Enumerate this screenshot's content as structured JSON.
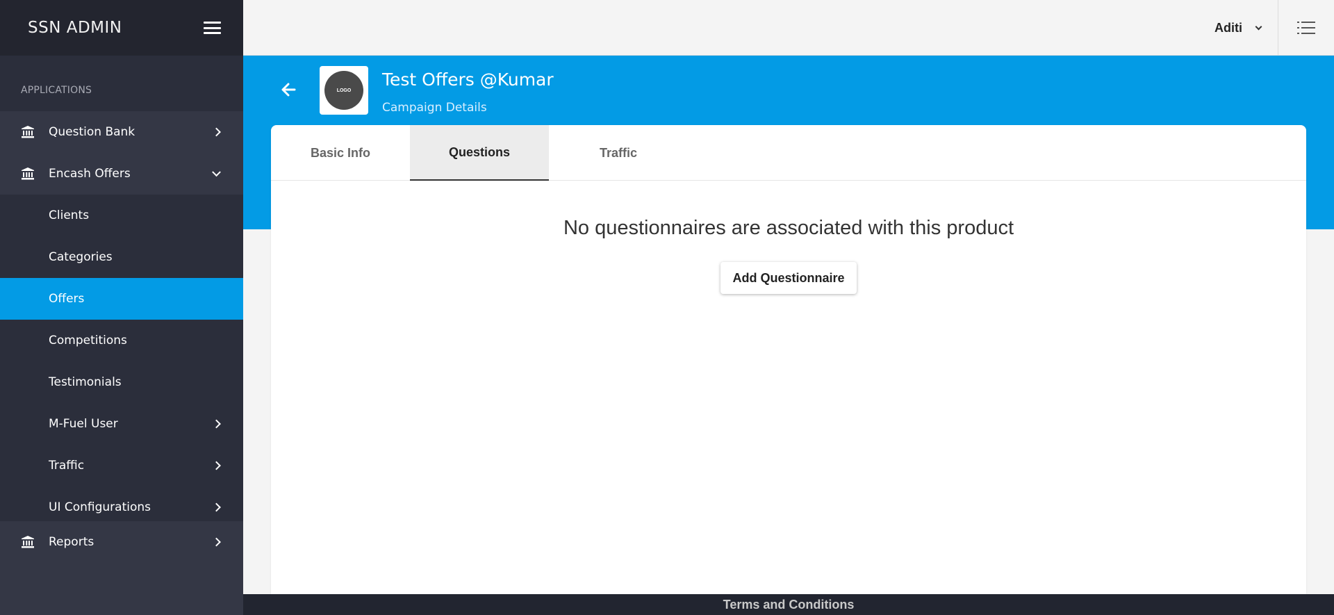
{
  "brand": {
    "title": "SSN ADMIN"
  },
  "sidebar": {
    "section_label": "APPLICATIONS",
    "items": [
      {
        "label": "Question Bank",
        "level": "top",
        "icon": "bank-icon",
        "chevron": "right"
      },
      {
        "label": "Encash Offers",
        "level": "top",
        "icon": "bank-icon",
        "chevron": "down"
      },
      {
        "label": "Clients",
        "level": "sub"
      },
      {
        "label": "Categories",
        "level": "sub"
      },
      {
        "label": "Offers",
        "level": "sub",
        "active": true
      },
      {
        "label": "Competitions",
        "level": "sub"
      },
      {
        "label": "Testimonials",
        "level": "sub"
      },
      {
        "label": "M-Fuel User",
        "level": "sub",
        "chevron": "right"
      },
      {
        "label": "Traffic",
        "level": "sub",
        "chevron": "right"
      },
      {
        "label": "UI Configurations",
        "level": "sub",
        "chevron": "right"
      },
      {
        "label": "Reports",
        "level": "top",
        "icon": "bank-icon",
        "chevron": "right"
      }
    ]
  },
  "topbar": {
    "user_name": "Aditi",
    "menu_icon": "list-icon"
  },
  "header": {
    "title": "Test Offers @Kumar",
    "subtitle": "Campaign Details",
    "logo_text": "LOGO",
    "back_icon": "arrow-left-icon"
  },
  "tabs": [
    {
      "label": "Basic Info",
      "active": false
    },
    {
      "label": "Questions",
      "active": true
    },
    {
      "label": "Traffic",
      "active": false
    }
  ],
  "main": {
    "empty_message": "No questionnaires are associated with this product",
    "add_button": "Add Questionnaire"
  },
  "footer": {
    "text": "Terms and Conditions"
  },
  "colors": {
    "accent": "#039be5",
    "sidebar_bg": "#2b2e3b",
    "sidebar_top_item_bg": "#343745",
    "brand_bg": "#23252f",
    "footer_bg": "#222530"
  }
}
